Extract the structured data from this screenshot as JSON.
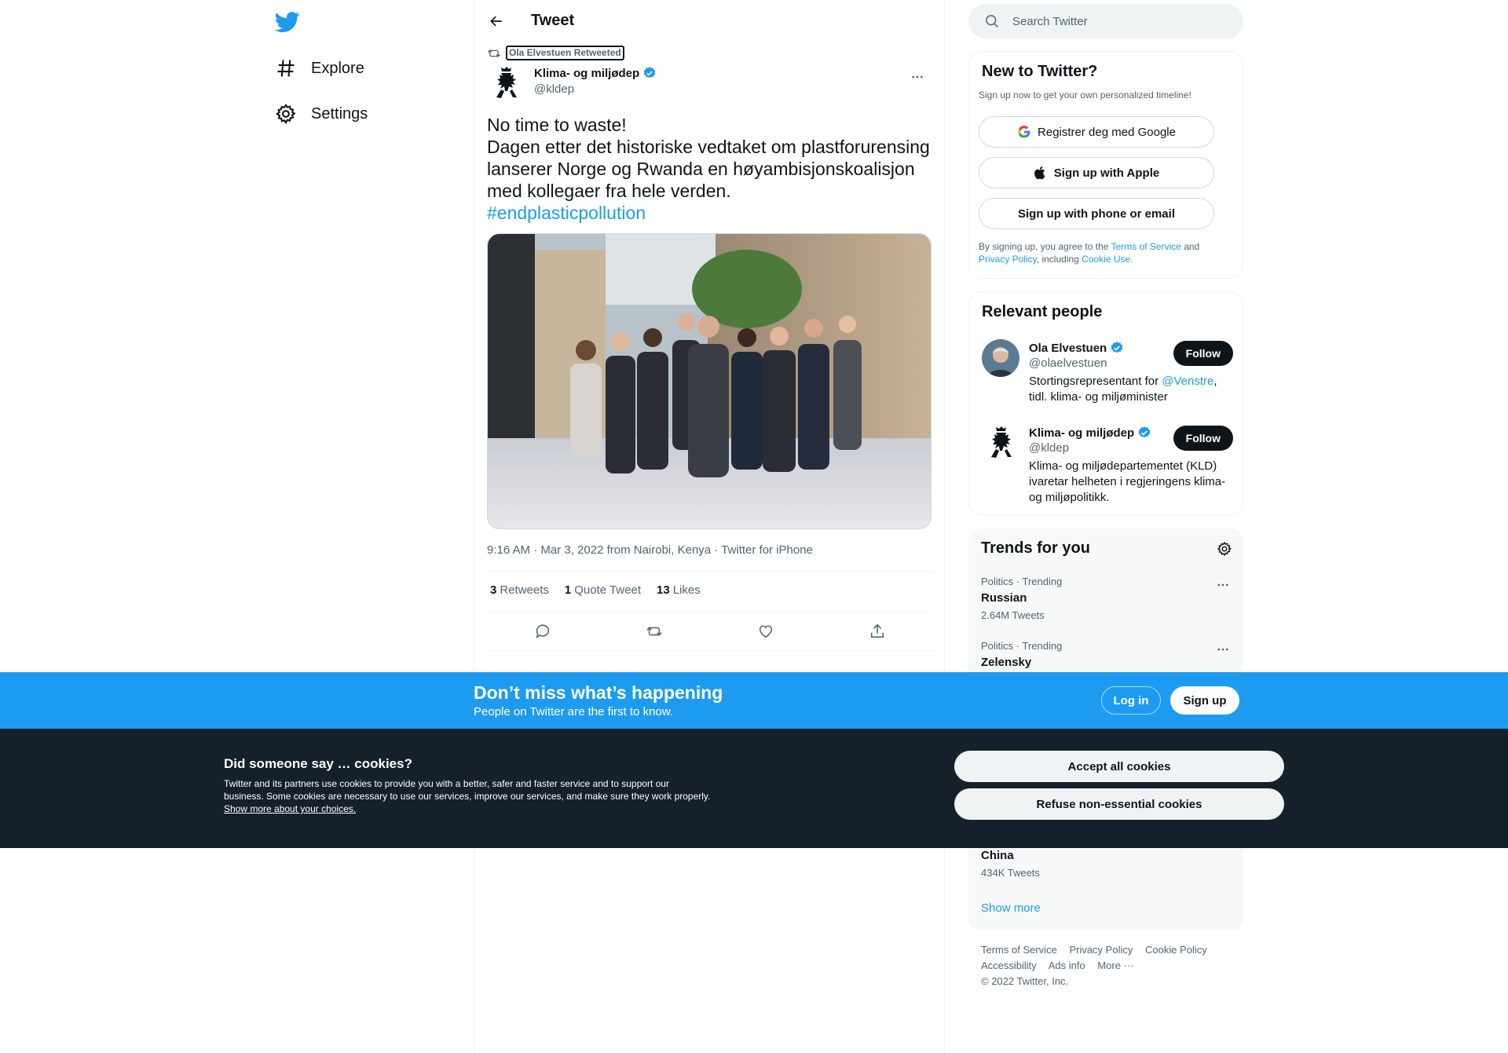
{
  "nav": {
    "logo": "twitter-bird-icon",
    "items": [
      {
        "label": "Explore",
        "icon": "hashtag-icon"
      },
      {
        "label": "Settings",
        "icon": "gear-icon"
      }
    ]
  },
  "header": {
    "title": "Tweet"
  },
  "tweet": {
    "retweeted_by": "Ola Elvestuen Retweeted",
    "author_name": "Klima- og miljødep",
    "author_handle": "@kldep",
    "text_lines": [
      "No time to waste!",
      "Dagen etter det historiske vedtaket om plastforurensing lanserer Norge og Rwanda en høyambisjonskoalisjon med kollegaer fra hele verden."
    ],
    "hashtag": "#endplasticpollution",
    "meta": "9:16 AM · Mar 3, 2022 from Nairobi, Kenya · Twitter for iPhone",
    "stats": {
      "retweets_count": "3",
      "retweets_label": "Retweets",
      "quotes_count": "1",
      "quotes_label": "Quote Tweet",
      "likes_count": "13",
      "likes_label": "Likes"
    }
  },
  "search": {
    "placeholder": "Search Twitter"
  },
  "new_to_twitter": {
    "title": "New to Twitter?",
    "subtitle": "Sign up now to get your own personalized timeline!",
    "google_label": "Registrer deg med Google",
    "apple_label": "Sign up with Apple",
    "phone_label": "Sign up with phone or email",
    "legal_prefix": "By signing up, you agree to the ",
    "terms": "Terms of Service",
    "and": " and",
    "privacy": "Privacy Policy",
    "including": ", including ",
    "cookie_use": "Cookie Use."
  },
  "relevant_people": {
    "title": "Relevant people",
    "people": [
      {
        "name": "Ola Elvestuen",
        "handle": "@olaelvestuen",
        "bio_prefix": "Stortingsrepresentant for ",
        "bio_link": "@Venstre",
        "bio_suffix": ", tidl. klima- og miljøminister",
        "follow": "Follow"
      },
      {
        "name": "Klima- og miljødep",
        "handle": "@kldep",
        "bio": "Klima- og miljødepartementet (KLD) ivaretar helheten i regjeringens klima- og miljøpolitikk.",
        "follow": "Follow"
      }
    ]
  },
  "trends": {
    "title": "Trends for you",
    "items": [
      {
        "category": "Politics · Trending",
        "name": "Russian",
        "count": "2.64M Tweets"
      },
      {
        "category": "Politics · Trending",
        "name": "Zelensky",
        "count": ""
      },
      {
        "category": "",
        "name": "China",
        "count": "434K Tweets"
      }
    ],
    "show_more": "Show more"
  },
  "footer": {
    "links_row1": [
      "Terms of Service",
      "Privacy Policy",
      "Cookie Policy"
    ],
    "links_row2": [
      "Accessibility",
      "Ads info",
      "More ···"
    ],
    "copyright": "© 2022 Twitter, Inc."
  },
  "banner": {
    "title": "Don’t miss what’s happening",
    "subtitle": "People on Twitter are the first to know.",
    "login": "Log in",
    "signup": "Sign up"
  },
  "cookies": {
    "title": "Did someone say … cookies?",
    "text": "Twitter and its partners use cookies to provide you with a better, safer and faster service and to support our business. Some cookies are necessary to use our services, improve our services, and make sure they work properly. ",
    "link": "Show more about your choices.",
    "accept": "Accept all cookies",
    "refuse": "Refuse non-essential cookies"
  },
  "colors": {
    "accent": "#1d9bf0",
    "text": "#0f1419",
    "secondary": "#536471",
    "cookie_bg": "#15202b"
  }
}
